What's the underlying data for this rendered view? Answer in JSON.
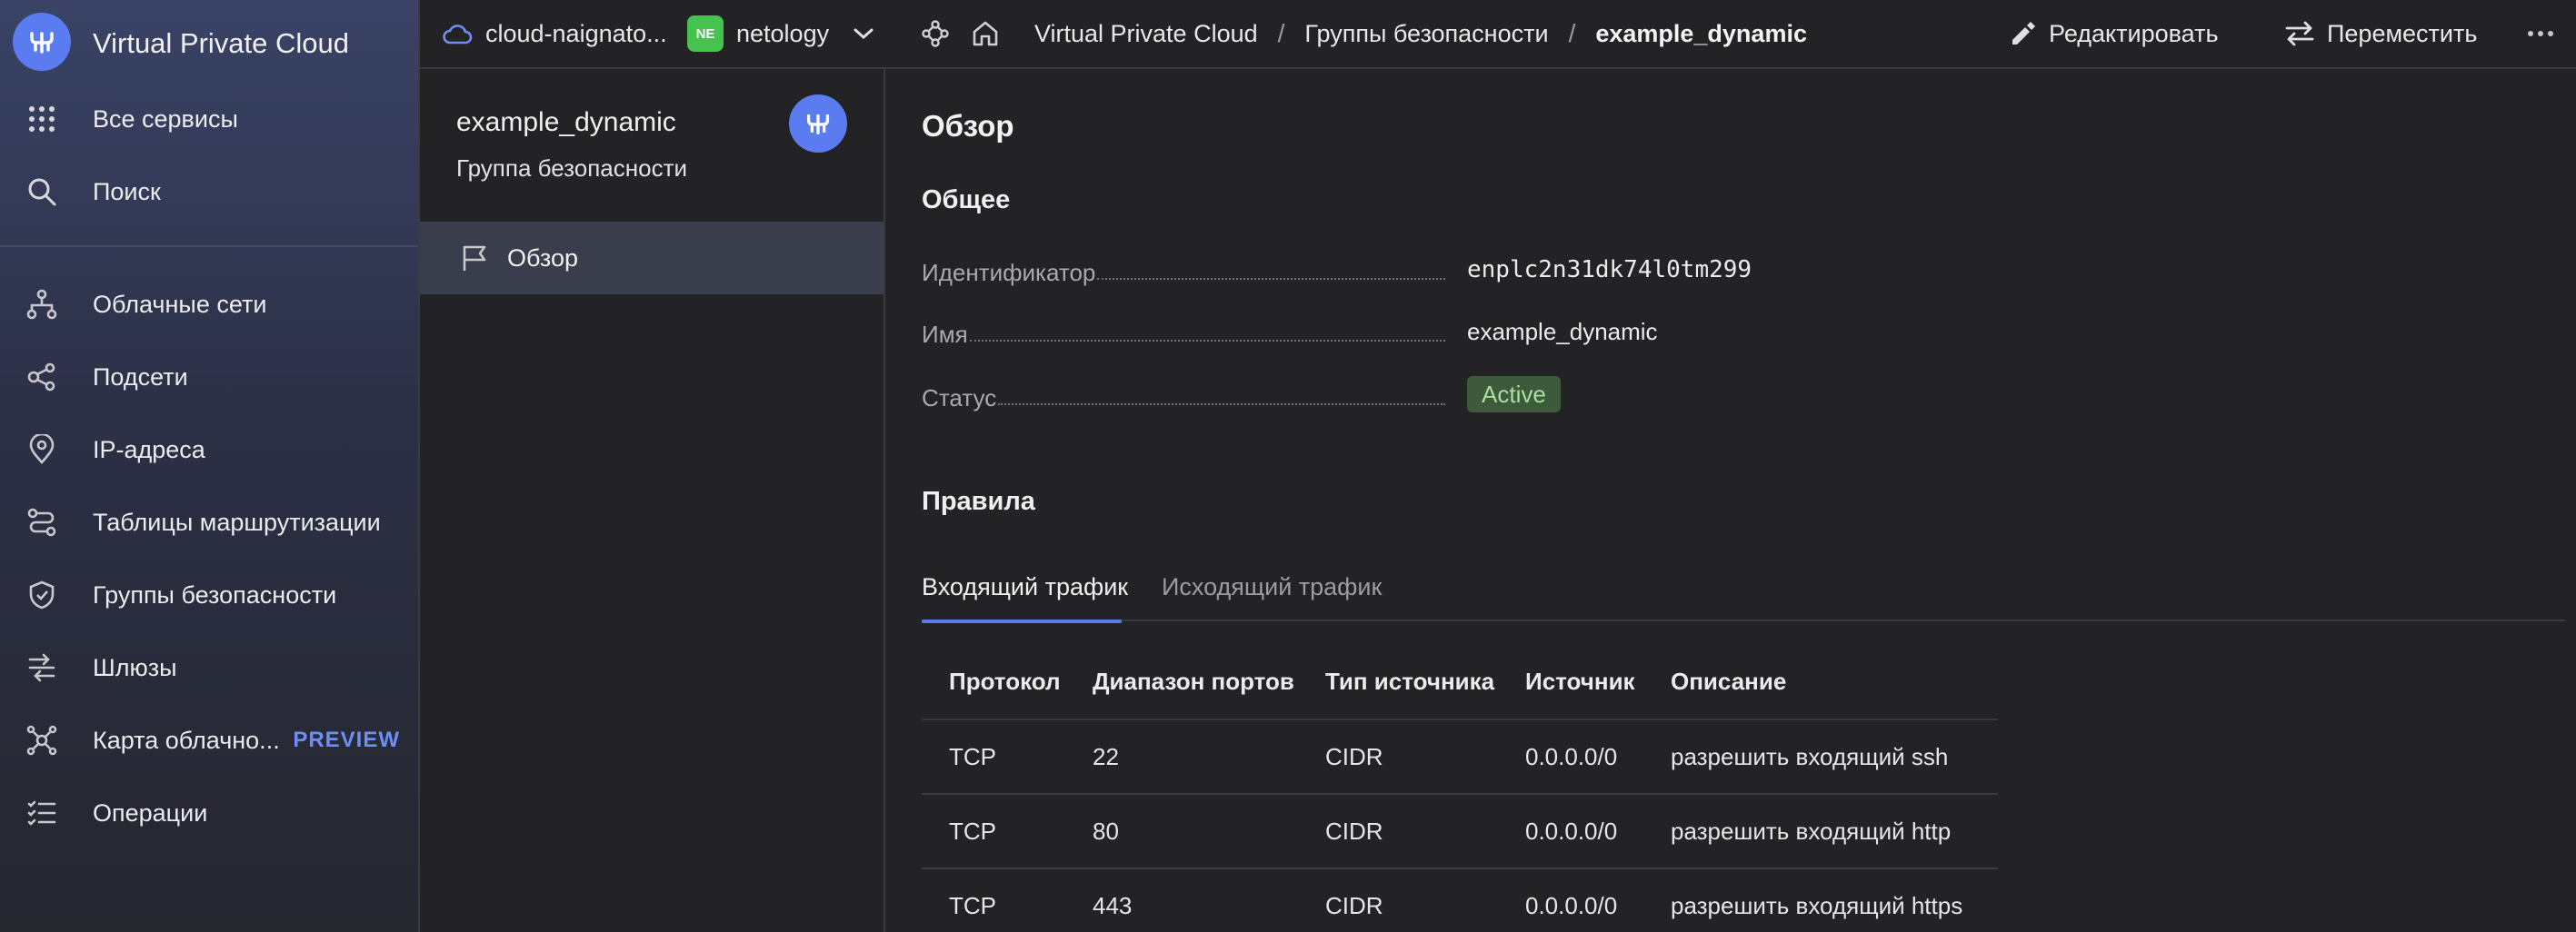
{
  "sidebar": {
    "title": "Virtual Private Cloud",
    "top_items": [
      {
        "label": "Все сервисы",
        "icon": "grid-icon"
      },
      {
        "label": "Поиск",
        "icon": "search-icon"
      }
    ],
    "items": [
      {
        "label": "Облачные сети",
        "icon": "network-icon"
      },
      {
        "label": "Подсети",
        "icon": "subnets-icon"
      },
      {
        "label": "IP-адреса",
        "icon": "location-pin-icon"
      },
      {
        "label": "Таблицы маршрутизации",
        "icon": "route-icon"
      },
      {
        "label": "Группы безопасности",
        "icon": "shield-icon"
      },
      {
        "label": "Шлюзы",
        "icon": "gateway-icon"
      },
      {
        "label": "Карта облачно...",
        "icon": "map-nodes-icon",
        "badge": "PREVIEW"
      },
      {
        "label": "Операции",
        "icon": "operations-list-icon"
      }
    ]
  },
  "topbar": {
    "cloud_name": "cloud-naignato...",
    "folder_badge": "NE",
    "folder_name": "netology",
    "breadcrumbs": [
      "Virtual Private Cloud",
      "Группы безопасности",
      "example_dynamic"
    ],
    "edit_label": "Редактировать",
    "move_label": "Переместить"
  },
  "resource": {
    "name": "example_dynamic",
    "type": "Группа безопасности",
    "nav_item": "Обзор"
  },
  "overview": {
    "title": "Обзор",
    "general_title": "Общее",
    "fields": [
      {
        "label": "Идентификатор",
        "value": "enplc2n31dk74l0tm299"
      },
      {
        "label": "Имя",
        "value": "example_dynamic"
      },
      {
        "label": "Статус",
        "value": "Active"
      }
    ],
    "rules_title": "Правила",
    "tabs": [
      "Входящий трафик",
      "Исходящий трафик"
    ],
    "active_tab": 0,
    "table": {
      "headers": [
        "Протокол",
        "Диапазон портов",
        "Тип источника",
        "Источник",
        "Описание"
      ],
      "rows": [
        [
          "TCP",
          "22",
          "CIDR",
          "0.0.0.0/0",
          "разрешить входящий ssh"
        ],
        [
          "TCP",
          "80",
          "CIDR",
          "0.0.0.0/0",
          "разрешить входящий http"
        ],
        [
          "TCP",
          "443",
          "CIDR",
          "0.0.0.0/0",
          "разрешить входящий https"
        ]
      ]
    }
  },
  "colors": {
    "accent": "#5b7cf0",
    "status_active_bg": "#3d5a3d",
    "status_active_text": "#a9dfa0",
    "folder_badge": "#46c24e"
  }
}
